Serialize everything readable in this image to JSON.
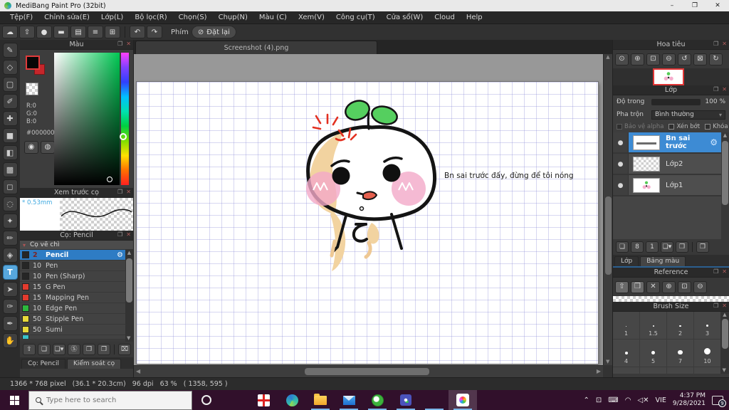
{
  "window": {
    "app_title": "MediBang Paint Pro (32bit)",
    "minimize": "–",
    "restore": "❐",
    "close": "✕"
  },
  "menu_items": [
    "Tệp(F)",
    "Chỉnh sửa(E)",
    "Lớp(L)",
    "Bộ lọc(R)",
    "Chọn(S)",
    "Chụp(N)",
    "Màu (C)",
    "Xem(V)",
    "Công cụ(T)",
    "Cửa sổ(W)",
    "Cloud",
    "Help"
  ],
  "toolbar": {
    "icons": [
      {
        "name": "cloud-icon",
        "glyph": "☁"
      },
      {
        "name": "export-icon",
        "glyph": "⇧"
      },
      {
        "name": "comment-bubble-icon",
        "glyph": "●"
      },
      {
        "name": "chat-bubble-icon",
        "glyph": "▬"
      },
      {
        "name": "document-icon",
        "glyph": "▤"
      },
      {
        "name": "list-icon",
        "glyph": "≡"
      },
      {
        "name": "grid-window-icon",
        "glyph": "⊞"
      }
    ],
    "undo_glyph": "↶",
    "redo_glyph": "↷",
    "phim_label": "Phím",
    "reset_icon": "⊘",
    "reset_label": "Đặt lại"
  },
  "document_tab": "Screenshot (4).png",
  "tool_strip": [
    {
      "name": "pen-tool-icon",
      "glyph": "✎"
    },
    {
      "name": "eraser-tool-icon",
      "glyph": "◇"
    },
    {
      "name": "figure-tool-icon",
      "glyph": "▢"
    },
    {
      "name": "figure-pen-tool-icon",
      "glyph": "✐"
    },
    {
      "name": "move-tool-icon",
      "glyph": "✚"
    },
    {
      "name": "fill-shape-tool-icon",
      "glyph": "■"
    },
    {
      "name": "bucket-tool-icon",
      "glyph": "◧"
    },
    {
      "name": "gradient-tool-icon",
      "glyph": "▩"
    },
    {
      "name": "select-tool-icon",
      "glyph": "◻"
    },
    {
      "name": "lasso-tool-icon",
      "glyph": "◌"
    },
    {
      "name": "magic-wand-tool-icon",
      "glyph": "✦"
    },
    {
      "name": "select-pen-tool-icon",
      "glyph": "✏"
    },
    {
      "name": "select-eraser-tool-icon",
      "glyph": "◈"
    },
    {
      "name": "text-tool-icon",
      "glyph": "T",
      "selected": true
    },
    {
      "name": "operation-tool-icon",
      "glyph": "➤"
    },
    {
      "name": "eyedropper-tool-icon",
      "glyph": "✑"
    },
    {
      "name": "div-tool-icon",
      "glyph": "✒"
    },
    {
      "name": "hand-tool-icon",
      "glyph": "✋"
    }
  ],
  "color_panel": {
    "title": "Màu",
    "popout": "❐",
    "close": "✕",
    "r_label": "R:0",
    "g_label": "G:0",
    "b_label": "B:0",
    "hex_label": "#000000",
    "palette_icon": "◉",
    "palette_add_icon": "◍",
    "foreground_color": "#000000",
    "background_color": "#c5262b"
  },
  "brush_preview_panel": {
    "title": "Xem trước cọ",
    "size_label": "* 0.53mm",
    "popout": "❐",
    "close": "✕"
  },
  "brush_panel": {
    "title": "Cọ: Pencil",
    "popout": "❐",
    "close": "✕",
    "group_caret": "▾",
    "group_label": "Cọ vẽ chì",
    "gear_glyph": "⚙",
    "brushes": [
      {
        "size": "2",
        "name": "Pencil",
        "swatch": "#262626",
        "selected": true
      },
      {
        "size": "10",
        "name": "Pen",
        "swatch": "#262626"
      },
      {
        "size": "10",
        "name": "Pen (Sharp)",
        "swatch": "#262626"
      },
      {
        "size": "15",
        "name": "G Pen",
        "swatch": "#e23b2e"
      },
      {
        "size": "15",
        "name": "Mapping Pen",
        "swatch": "#e23b2e"
      },
      {
        "size": "10",
        "name": "Edge Pen",
        "swatch": "#2db83d"
      },
      {
        "size": "50",
        "name": "Stipple Pen",
        "swatch": "#e7d93a"
      },
      {
        "size": "50",
        "name": "Sumi",
        "swatch": "#e7d93a"
      },
      {
        "size": "",
        "name": "",
        "swatch": "#39c2c9",
        "partial": true
      }
    ],
    "toolbar_icons": [
      {
        "name": "brush-cloud-icon",
        "glyph": "⇧"
      },
      {
        "name": "add-brush-icon",
        "glyph": "❏"
      },
      {
        "name": "add-brush-menu-icon",
        "glyph": "❏▾"
      },
      {
        "name": "script-brush-icon",
        "glyph": "Ⓢ"
      },
      {
        "name": "brush-folder-icon",
        "glyph": "❒"
      },
      {
        "name": "duplicate-brush-icon",
        "glyph": "❐"
      },
      {
        "name": "delete-brush-icon",
        "glyph": "⌧"
      }
    ],
    "tab_active": "Cọ: Pencil",
    "tab_inactive": "Kiểm soát cọ"
  },
  "canvas": {
    "speech_text": "Bn sai trước đấy, đừng để tôi nóng"
  },
  "scroll": {
    "up": "▲",
    "down": "▼",
    "left": "◀",
    "right": "▶"
  },
  "navigator_panel": {
    "title": "Hoa tiêu",
    "popout": "❐",
    "close": "✕",
    "icons": [
      {
        "name": "zoom-tool-icon",
        "glyph": "⊙"
      },
      {
        "name": "zoom-in-icon",
        "glyph": "⊕"
      },
      {
        "name": "fit-window-icon",
        "glyph": "⊡"
      },
      {
        "name": "zoom-out-icon",
        "glyph": "⊖"
      },
      {
        "name": "rotate-left-icon",
        "glyph": "↺"
      },
      {
        "name": "reset-rotation-icon",
        "glyph": "⊠"
      },
      {
        "name": "rotate-right-icon",
        "glyph": "↻"
      }
    ]
  },
  "layers_panel": {
    "title": "Lớp",
    "popout": "❐",
    "close": "✕",
    "opacity_label": "Độ trong",
    "opacity_value": "100 %",
    "blend_label": "Pha trộn",
    "blend_value": "Bình thường",
    "blend_caret": "▾",
    "checkbox_labels": [
      "Bảo vệ alpha",
      "Xén bớt",
      "Khóa"
    ],
    "eye_glyph": "●",
    "gear_glyph": "⚙",
    "layers": [
      {
        "name": "Bn sai trước",
        "thumb": "text",
        "selected": true
      },
      {
        "name": "Lớp2",
        "thumb": "checker"
      },
      {
        "name": "Lớp1",
        "thumb": "art"
      }
    ],
    "toolbar_icons": [
      {
        "name": "new-layer-icon",
        "glyph": "❏"
      },
      {
        "name": "new-8bit-layer-icon",
        "glyph": "8"
      },
      {
        "name": "new-1bit-layer-icon",
        "glyph": "1"
      },
      {
        "name": "add-layer-menu-icon",
        "glyph": "❏▾"
      },
      {
        "name": "layer-folder-icon",
        "glyph": "❒"
      },
      {
        "name": "duplicate-layer-icon",
        "glyph": "❐"
      }
    ],
    "tab_active": "Lớp",
    "tab_inactive": "Bảng màu"
  },
  "reference_panel": {
    "title": "Reference",
    "popout": "❐",
    "close": "✕",
    "icons": [
      {
        "name": "ref-home-icon",
        "glyph": "⇧",
        "lit": true
      },
      {
        "name": "ref-open-folder-icon",
        "glyph": "❒",
        "lit": true
      },
      {
        "name": "ref-clear-icon",
        "glyph": "✕"
      },
      {
        "name": "ref-zoom-in-icon",
        "glyph": "⊕"
      },
      {
        "name": "ref-fit-icon",
        "glyph": "⊡"
      },
      {
        "name": "ref-zoom-out-icon",
        "glyph": "⊖"
      }
    ]
  },
  "brush_size_panel": {
    "title": "Brush Size",
    "popout": "❐",
    "close": "✕",
    "sizes": [
      {
        "label": "1",
        "d": 1.5
      },
      {
        "label": "1.5",
        "d": 2
      },
      {
        "label": "2",
        "d": 2.5
      },
      {
        "label": "3",
        "d": 3.5
      },
      {
        "label": "4",
        "d": 4
      },
      {
        "label": "5",
        "d": 5
      },
      {
        "label": "7",
        "d": 6.5
      },
      {
        "label": "10",
        "d": 9
      },
      {
        "label": "",
        "d": 13,
        "partial": true
      },
      {
        "label": "",
        "d": 14,
        "partial": true
      },
      {
        "label": "",
        "d": 16,
        "partial": true
      },
      {
        "label": "",
        "d": 18,
        "partial": true
      }
    ]
  },
  "status_bar": "1366 * 768 pixel   (36.1 * 20.3cm)   96 dpi   63 %   ( 1358, 595 )",
  "taskbar": {
    "search_placeholder": "Type here to search",
    "apps": [
      {
        "name": "cortana"
      },
      {
        "name": "task-view"
      },
      {
        "name": "gift"
      },
      {
        "name": "edge"
      },
      {
        "name": "explorer",
        "open": true
      },
      {
        "name": "mail",
        "open": true
      },
      {
        "name": "coccoc",
        "open": true
      },
      {
        "name": "teams",
        "open": true
      },
      {
        "name": "anime-app",
        "open": true
      },
      {
        "name": "medibang",
        "open": true,
        "active": true
      }
    ],
    "tray_icons": [
      {
        "name": "tray-chevron-icon",
        "glyph": "⌃"
      },
      {
        "name": "meet-now-icon",
        "glyph": "⊡"
      },
      {
        "name": "touch-keyboard-icon",
        "glyph": "⌨"
      },
      {
        "name": "wifi-icon",
        "glyph": "◠"
      },
      {
        "name": "volume-mute-icon",
        "glyph": "◁✕"
      }
    ],
    "language": "VIE",
    "time": "4:37 PM",
    "date": "9/28/2021",
    "notification_count": "9"
  }
}
